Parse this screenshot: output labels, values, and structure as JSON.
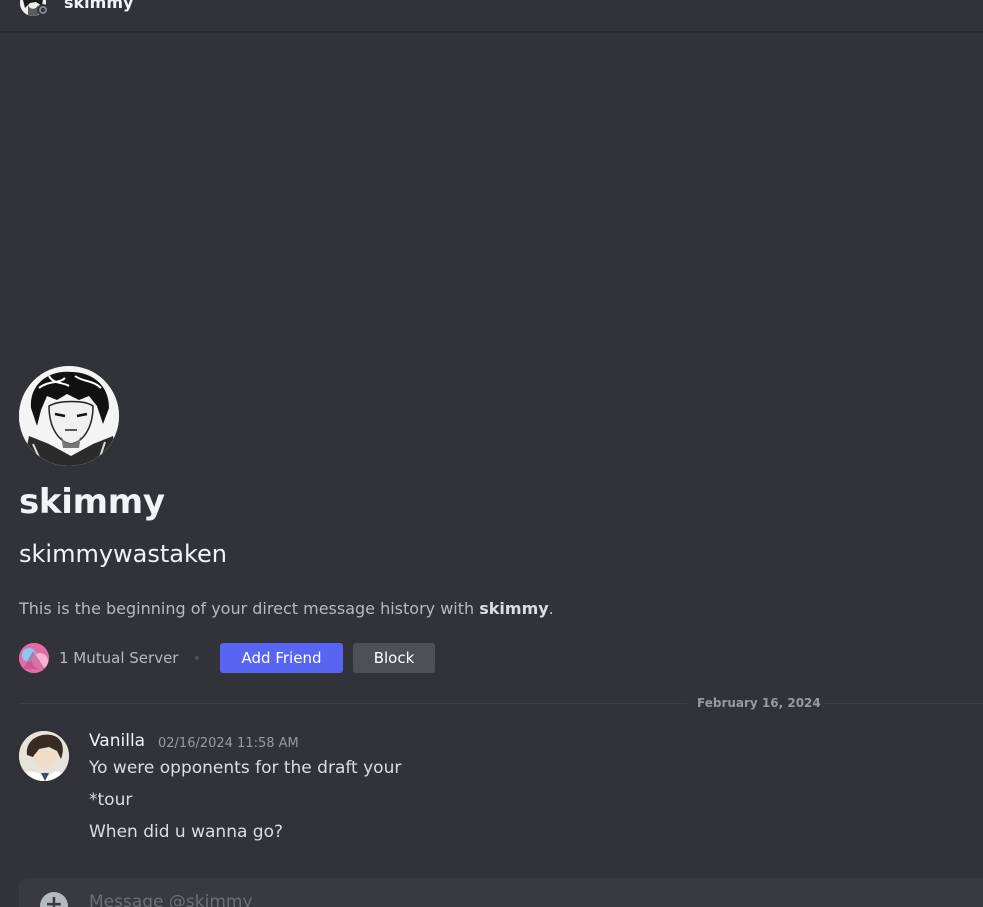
{
  "header": {
    "name": "skimmy",
    "avatar_icon": "user-avatar-icon",
    "status_icon": "offline-status-icon"
  },
  "profile": {
    "display_name": "skimmy",
    "username": "skimmywastaken",
    "intro_prefix": "This is the beginning of your direct message history with ",
    "intro_name": "skimmy",
    "intro_suffix": ".",
    "mutual_servers": "1 Mutual Server",
    "add_friend_label": "Add Friend",
    "block_label": "Block"
  },
  "divider": {
    "date": "February 16, 2024"
  },
  "messages": [
    {
      "author": "Vanilla",
      "timestamp": "02/16/2024 11:58 AM",
      "lines": [
        "Yo were opponents for the draft your",
        "*tour",
        "When did u wanna go?"
      ]
    }
  ],
  "composer": {
    "placeholder": "Message @skimmy"
  },
  "colors": {
    "background": "#313338",
    "brand": "#5865f2",
    "secondary_button": "#4e5058",
    "composer_bg": "#383a40"
  }
}
